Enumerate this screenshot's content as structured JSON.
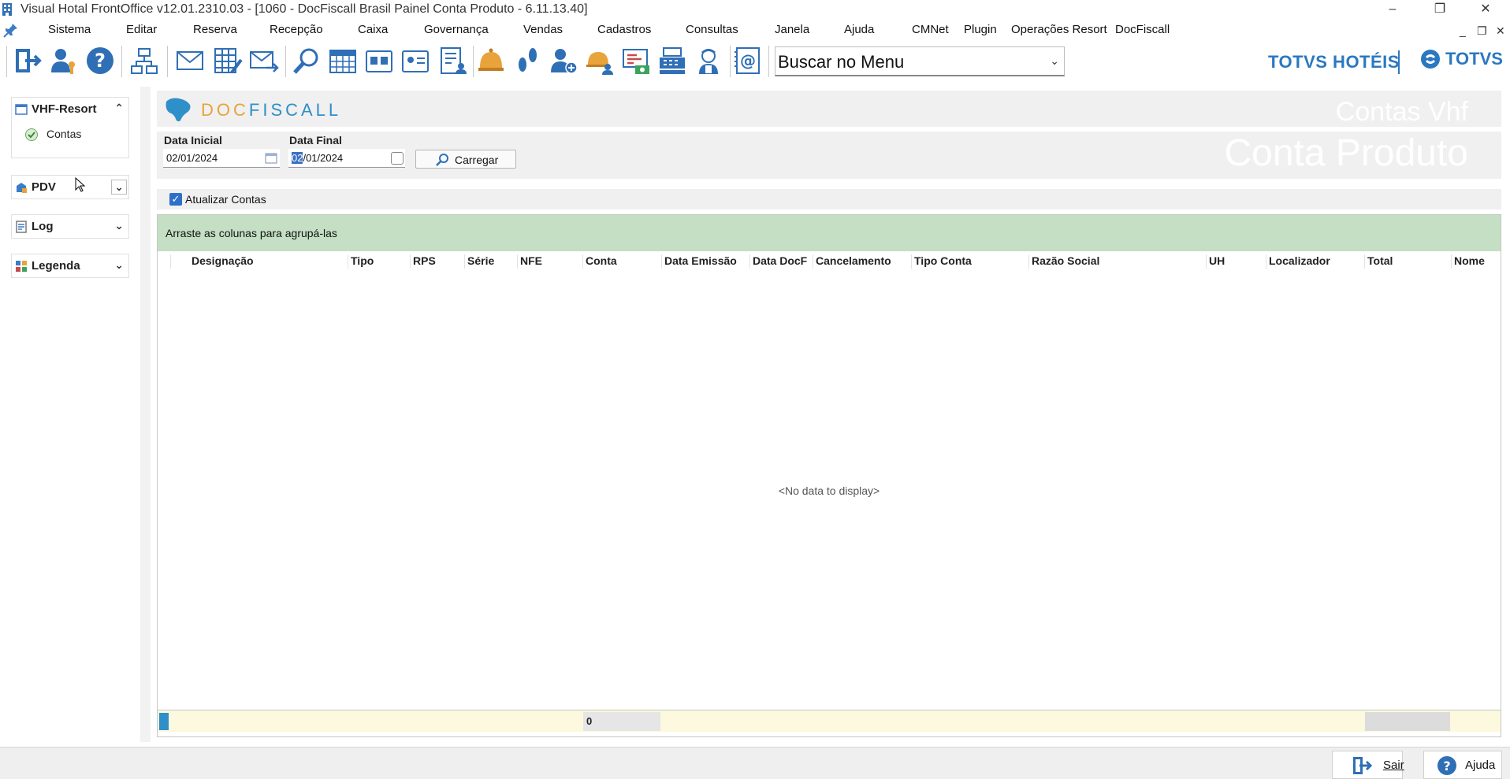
{
  "window": {
    "title": "Visual Hotal FrontOffice v12.01.2310.03 - [1060 - DocFiscall Brasil Painel Conta Produto - 6.11.13.40]",
    "minimize": "–",
    "restore": "❐",
    "close": "✕"
  },
  "menu": {
    "items": [
      "Sistema",
      "Editar",
      "Reserva",
      "Recepção",
      "Caixa",
      "Governança",
      "Vendas",
      "Cadastros",
      "Consultas",
      "Janela",
      "Ajuda",
      "CMNet",
      "Plugin",
      "Operações Resort",
      "DocFiscall"
    ],
    "mdi_minimize": "_",
    "mdi_restore": "❐",
    "mdi_close": "✕"
  },
  "toolbar": {
    "menu_search_value": "Buscar no Menu",
    "brand_left": "TOTVS HOTÉIS",
    "brand_right": "TOTVS",
    "icons": [
      "exit-icon",
      "user-key-icon",
      "help-icon",
      "hierarchy-icon",
      "mail-icon",
      "spreadsheet-pen-icon",
      "mail-send-icon",
      "search-icon",
      "calendar-icon",
      "card-icon",
      "id-card-icon",
      "report-user-icon",
      "bell-icon",
      "footprints-icon",
      "add-user-icon",
      "bell-users-icon",
      "money-chart-icon",
      "cash-register-icon",
      "maid-icon",
      "email-at-icon"
    ]
  },
  "sidebar": {
    "groups": [
      {
        "label": "VHF-Resort",
        "chevron": "⌃",
        "items": [
          {
            "label": "Contas"
          }
        ]
      },
      {
        "label": "PDV",
        "chevron": "⌄"
      },
      {
        "label": "Log",
        "chevron": "⌄"
      },
      {
        "label": "Legenda",
        "chevron": "⌄"
      }
    ]
  },
  "main": {
    "logo": {
      "part1": "DOC",
      "part2": "FISCALL"
    },
    "watermark_top": "Contas Vhf",
    "watermark_bottom": "Conta Produto",
    "filters": {
      "data_inicial_label": "Data Inicial",
      "data_inicial_value": "02/01/2024",
      "data_final_label": "Data Final",
      "data_final_selected": "02",
      "data_final_rest": "/01/2024",
      "carregar_label": "Carregar"
    },
    "atualizar_label": "Atualizar Contas",
    "atualizar_checked": true,
    "grid": {
      "group_panel_text": "Arraste as colunas para agrupá-las",
      "columns": [
        "Designação",
        "Tipo",
        "RPS",
        "Série",
        "NFE",
        "Conta",
        "Data Emissão",
        "Data DocF",
        "Cancelamento",
        "Tipo Conta",
        "Razão Social",
        "UH",
        "Localizador",
        "Total",
        "Nome"
      ],
      "empty_text": "<No data to display>",
      "footer_count": "0"
    }
  },
  "statusbar": {
    "sair_label": "Sair",
    "ajuda_label": "Ajuda"
  },
  "colors": {
    "accent": "#2a78c0",
    "group_panel": "#c4dfc3",
    "footer": "#fcf9df"
  }
}
